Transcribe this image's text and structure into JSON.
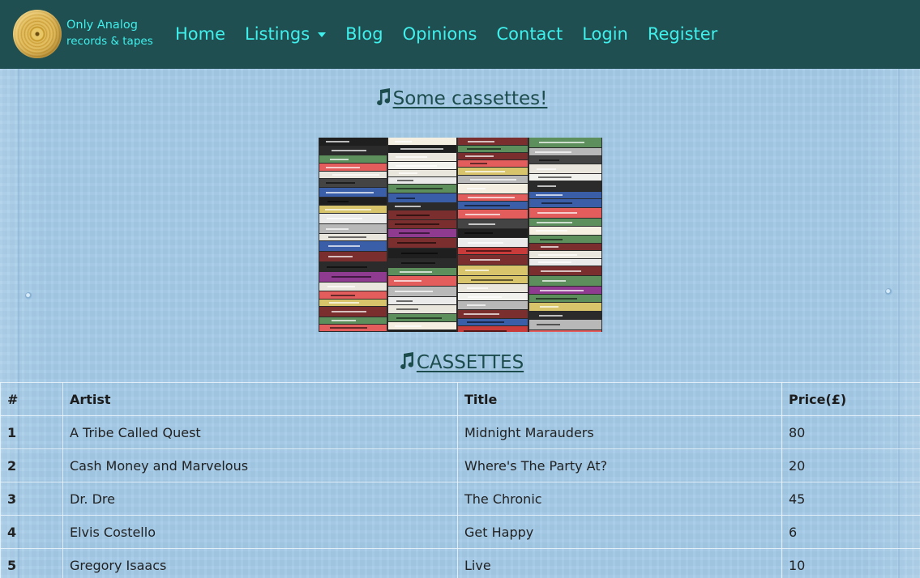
{
  "brand": {
    "line1": "Only Analog",
    "line2": "records & tapes"
  },
  "nav": {
    "home": "Home",
    "listings": "Listings",
    "blog": "Blog",
    "opinions": "Opinions",
    "contact": "Contact",
    "login": "Login",
    "register": "Register"
  },
  "headings": {
    "some_cassettes": "Some cassettes!",
    "cassettes": "CASSETTES"
  },
  "icons": {
    "brand_logo": "vinyl-record-icon",
    "heading_icon": "music-note-icon"
  },
  "colors": {
    "navbar_bg": "#204f51",
    "nav_text": "#3ff0ec",
    "heading_text": "#1d4c4d",
    "page_bg": "#a5cbe8"
  },
  "table": {
    "headers": [
      "#",
      "Artist",
      "Title",
      "Price(£)"
    ],
    "rows": [
      {
        "num": "1",
        "artist": "A Tribe Called Quest",
        "title": "Midnight Marauders",
        "price": "80"
      },
      {
        "num": "2",
        "artist": "Cash Money and Marvelous",
        "title": "Where's The Party At?",
        "price": "20"
      },
      {
        "num": "3",
        "artist": "Dr. Dre",
        "title": "The Chronic",
        "price": "45"
      },
      {
        "num": "4",
        "artist": "Elvis Costello",
        "title": "Get Happy",
        "price": "6"
      },
      {
        "num": "5",
        "artist": "Gregory Isaacs",
        "title": "Live",
        "price": "10"
      }
    ]
  }
}
